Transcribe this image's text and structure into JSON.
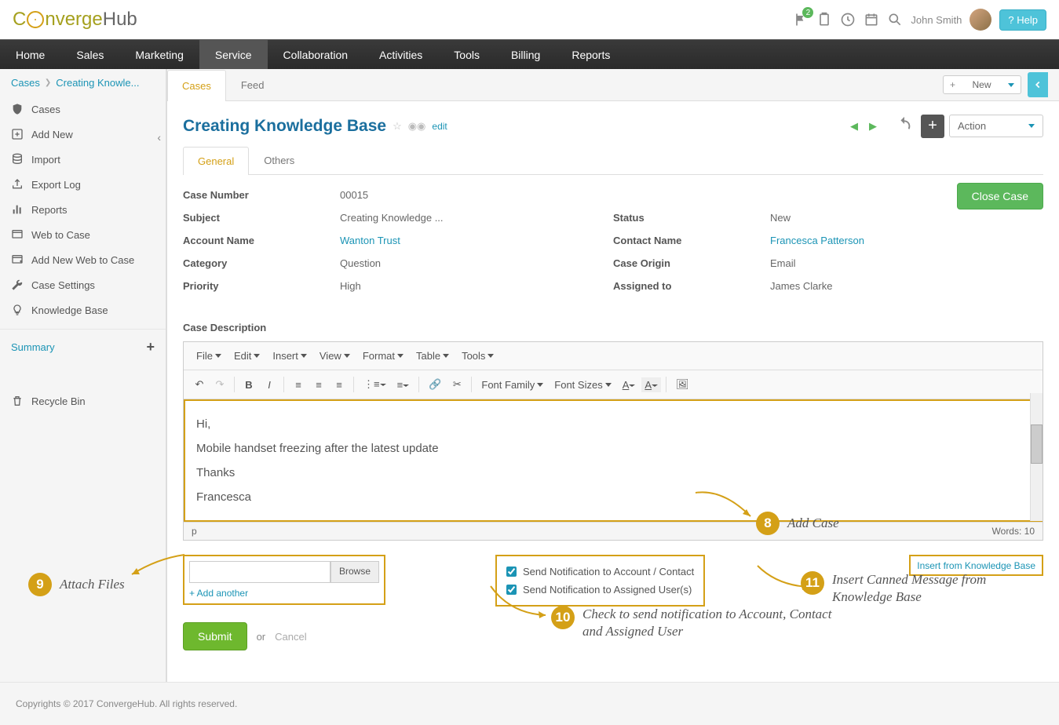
{
  "header": {
    "logo_part1": "C",
    "logo_part2": "nverge",
    "logo_part3": "Hub",
    "notif_badge": "2",
    "user_name": "John Smith",
    "help_label": "? Help"
  },
  "nav": [
    "Home",
    "Sales",
    "Marketing",
    "Service",
    "Collaboration",
    "Activities",
    "Tools",
    "Billing",
    "Reports"
  ],
  "nav_active": 3,
  "breadcrumb": {
    "item1": "Cases",
    "item2": "Creating Knowle..."
  },
  "sidebar": {
    "items": [
      {
        "icon": "shield",
        "label": "Cases"
      },
      {
        "icon": "plus",
        "label": "Add New"
      },
      {
        "icon": "db",
        "label": "Import"
      },
      {
        "icon": "export",
        "label": "Export Log"
      },
      {
        "icon": "bars",
        "label": "Reports"
      },
      {
        "icon": "web",
        "label": "Web to Case"
      },
      {
        "icon": "webplus",
        "label": "Add New Web to Case"
      },
      {
        "icon": "wrench",
        "label": "Case Settings"
      },
      {
        "icon": "bulb",
        "label": "Knowledge Base"
      }
    ],
    "summary": "Summary",
    "recycle": "Recycle Bin"
  },
  "top_tabs": {
    "t1": "Cases",
    "t2": "Feed",
    "new_label": "New"
  },
  "title": {
    "text": "Creating Knowledge Base",
    "edit": "edit",
    "action": "Action"
  },
  "detail_tabs": {
    "t1": "General",
    "t2": "Others"
  },
  "close_case": "Close Case",
  "fields": {
    "case_number": {
      "label": "Case Number",
      "value": "00015"
    },
    "subject": {
      "label": "Subject",
      "value": "Creating Knowledge ..."
    },
    "status": {
      "label": "Status",
      "value": "New"
    },
    "account_name": {
      "label": "Account Name",
      "value": "Wanton Trust"
    },
    "contact_name": {
      "label": "Contact Name",
      "value": "Francesca Patterson"
    },
    "category": {
      "label": "Category",
      "value": "Question"
    },
    "case_origin": {
      "label": "Case Origin",
      "value": "Email"
    },
    "priority": {
      "label": "Priority",
      "value": "High"
    },
    "assigned_to": {
      "label": "Assigned to",
      "value": "James Clarke"
    }
  },
  "desc_label": "Case Description",
  "editor": {
    "menu": [
      "File",
      "Edit",
      "Insert",
      "View",
      "Format",
      "Table",
      "Tools"
    ],
    "toolbar_dd": [
      "Font Family",
      "Font Sizes"
    ],
    "body_lines": [
      "Hi,",
      "Mobile handset freezing after the latest update",
      "Thanks",
      "Francesca"
    ],
    "status_path": "p",
    "word_count": "Words: 10"
  },
  "attach": {
    "browse": "Browse",
    "add_another": "+ Add another"
  },
  "notify": {
    "row1": "Send Notification to Account / Contact",
    "row2": "Send Notification to Assigned User(s)"
  },
  "kb_insert": "Insert from Knowledge Base",
  "submit": {
    "submit": "Submit",
    "or": "or",
    "cancel": "Cancel"
  },
  "annotations": {
    "a8": {
      "num": "8",
      "text": "Add Case"
    },
    "a9": {
      "num": "9",
      "text": "Attach Files"
    },
    "a10": {
      "num": "10",
      "text": "Check to send notification to Account, Contact and Assigned User"
    },
    "a11": {
      "num": "11",
      "text": "Insert Canned Message from Knowledge Base"
    }
  },
  "footer": "Copyrights © 2017 ConvergeHub. All rights reserved."
}
